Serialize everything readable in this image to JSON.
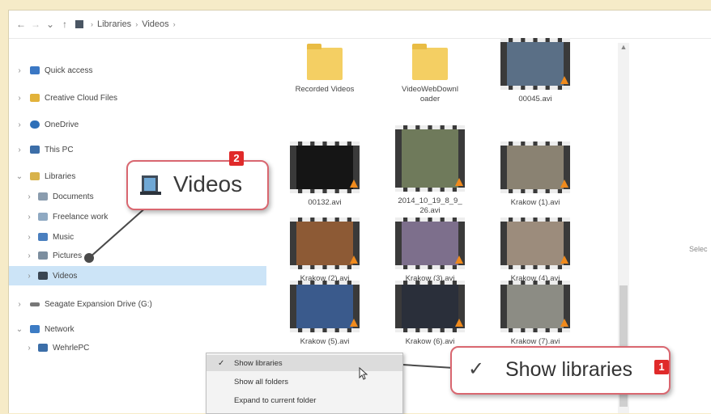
{
  "address_bar": {
    "back": "←",
    "forward": "→",
    "recent": "⌄",
    "up": "↑",
    "crumbs": [
      "Libraries",
      "Videos"
    ],
    "crumb_separator": "›"
  },
  "nav_pane": {
    "items": [
      {
        "label": "Quick access",
        "icon": "star-icon",
        "color": "#3b78c4",
        "chevron": "›"
      },
      {
        "label": "Creative Cloud Files",
        "icon": "folder-icon",
        "color": "#e2b23a",
        "chevron": "›"
      },
      {
        "label": "OneDrive",
        "icon": "cloud-icon",
        "color": "#2d6fb8",
        "chevron": "›"
      },
      {
        "label": "This PC",
        "icon": "pc-icon",
        "color": "#3c6ea8",
        "chevron": "›"
      },
      {
        "label": "Libraries",
        "icon": "library-icon",
        "color": "#d8b24a",
        "chevron": "⌄"
      },
      {
        "label": "Documents",
        "icon": "documents-icon",
        "color": "#8a9cae",
        "chevron": "›"
      },
      {
        "label": "Freelance work",
        "icon": "library-icon",
        "color": "#8fa9c2",
        "chevron": "›"
      },
      {
        "label": "Music",
        "icon": "music-icon",
        "color": "#4a7fbf",
        "chevron": "›"
      },
      {
        "label": "Pictures",
        "icon": "pictures-icon",
        "color": "#7c8e9f",
        "chevron": "›"
      },
      {
        "label": "Videos",
        "icon": "videos-icon",
        "color": "#394552",
        "chevron": "›",
        "selected": true
      },
      {
        "label": "Seagate Expansion Drive (G:)",
        "icon": "drive-icon",
        "color": "#777777",
        "chevron": "›"
      },
      {
        "label": "Network",
        "icon": "network-icon",
        "color": "#3d7cc4",
        "chevron": "⌄"
      },
      {
        "label": "WehrlePC",
        "icon": "pc-icon",
        "color": "#3c6ea8",
        "chevron": "›"
      }
    ]
  },
  "files": [
    {
      "label": "Recorded Videos",
      "type": "folder"
    },
    {
      "label": "VideoWebDownloader",
      "label_lines": [
        "VideoWebDownl",
        "oader"
      ],
      "type": "folder"
    },
    {
      "label": "00045.avi",
      "type": "video",
      "tint": "#5a6f86"
    },
    {
      "label": "00132.avi",
      "type": "video",
      "tint": "#151515"
    },
    {
      "label": "2014_10_19_8_9_26.avi",
      "label_lines": [
        "2014_10_19_8_9_",
        "26.avi"
      ],
      "type": "video",
      "tint": "#6f7a5b"
    },
    {
      "label": "Krakow (1).avi",
      "type": "video",
      "tint": "#8a8272"
    },
    {
      "label": "Krakow (2).avi",
      "type": "video",
      "tint": "#8d5a35"
    },
    {
      "label": "Krakow (3).avi",
      "type": "video",
      "tint": "#7d6f8c"
    },
    {
      "label": "Krakow (4).avi",
      "type": "video",
      "tint": "#9c8c7c"
    },
    {
      "label": "Krakow (5).avi",
      "type": "video",
      "tint": "#3a5a8c"
    },
    {
      "label": "Krakow (6).avi",
      "type": "video",
      "tint": "#2a2f3a"
    },
    {
      "label": "Krakow (7).avi",
      "type": "video",
      "tint": "#8c8c84"
    }
  ],
  "preview_pane": {
    "text": "Selec"
  },
  "context_menu": {
    "items": [
      {
        "label": "Show libraries",
        "checked": true,
        "check": "✓"
      },
      {
        "label": "Show all folders",
        "checked": false
      },
      {
        "label": "Expand to current folder",
        "checked": false
      }
    ]
  },
  "callouts": {
    "videos": {
      "label": "Videos",
      "badge": "2",
      "icon": "videos-icon"
    },
    "show_libraries": {
      "label": "Show libraries",
      "badge": "1",
      "check": "✓"
    }
  },
  "colors": {
    "accent_badge": "#e02a2a",
    "callout_border": "#d96770",
    "selection": "#cce4f7",
    "page_background": "#f6ebc8"
  }
}
